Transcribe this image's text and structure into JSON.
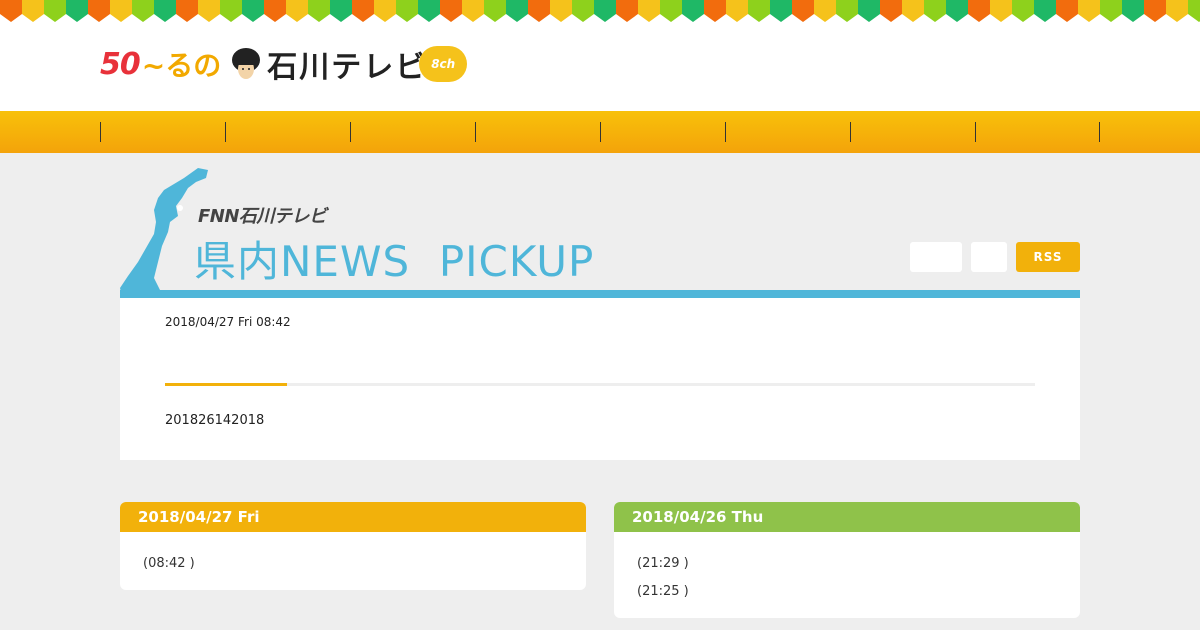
{
  "header": {
    "logo": {
      "anniversary": "50",
      "wave": "~るの",
      "station_name": "石川テレビ",
      "channel": "8ch"
    },
    "bunting_colors": [
      "#f26c0d",
      "#f5c21b",
      "#8ed11c",
      "#1fb866"
    ]
  },
  "nav": {
    "background": "#f6b10a",
    "items": [
      "",
      "",
      "",
      "",
      "",
      "",
      "",
      "",
      ""
    ]
  },
  "hero": {
    "network": "FNN石川テレビ",
    "title": "県内NEWS  PICKUP",
    "title_color": "#4fb6d9",
    "buttons": [
      "",
      "",
      "RSS"
    ],
    "rss_color": "#f2b10b"
  },
  "article": {
    "date": "2018/04/27 Fri 08:42",
    "progress": 0.14,
    "text": "201826142018"
  },
  "days": [
    {
      "date": "2018/04/27 Fri",
      "color": "#f2b10b",
      "items": [
        "(08:42 )"
      ]
    },
    {
      "date": "2018/04/26 Thu",
      "color": "#8fc24a",
      "items": [
        "(21:29 )",
        "(21:25 )"
      ]
    }
  ]
}
